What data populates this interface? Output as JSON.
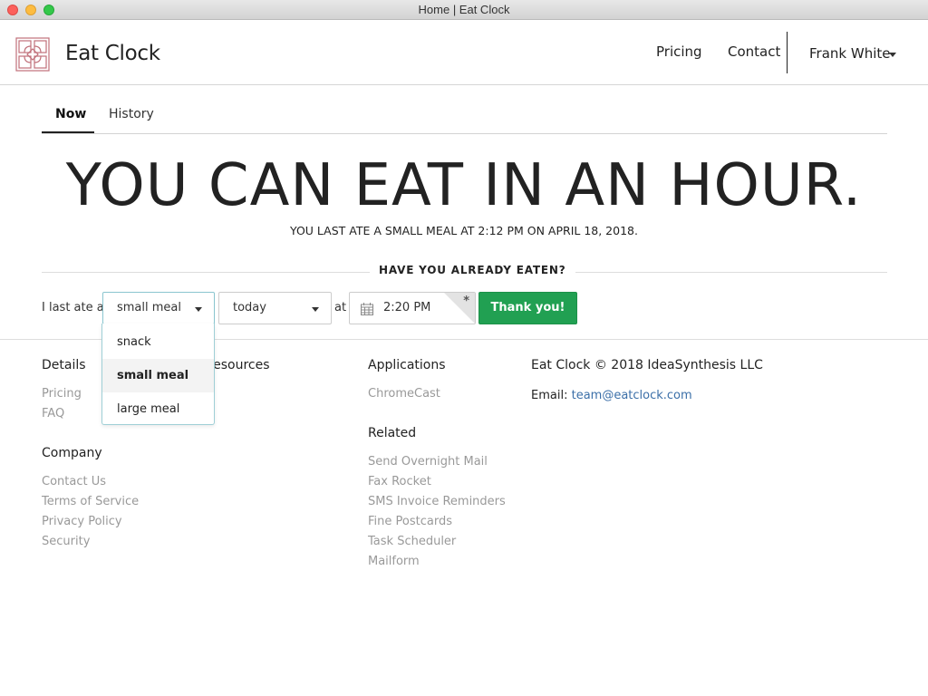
{
  "window": {
    "title": "Home | Eat Clock"
  },
  "navbar": {
    "brand": "Eat Clock",
    "links": [
      "Pricing",
      "Contact"
    ],
    "user": "Frank White"
  },
  "tabs": [
    {
      "label": "Now",
      "active": true
    },
    {
      "label": "History",
      "active": false
    }
  ],
  "status": {
    "headline": "YOU CAN EAT IN AN HOUR.",
    "last_meal": "YOU LAST ATE A SMALL MEAL AT 2:12 PM ON APRIL 18, 2018."
  },
  "form": {
    "section_title": "HAVE YOU ALREADY EATEN?",
    "label_prefix": "I last ate a",
    "meal_selected": "small meal",
    "meal_options": [
      "snack",
      "small meal",
      "large meal"
    ],
    "day_selected": "today",
    "label_at": "at",
    "time_value": "2:20 PM",
    "required_mark": "*",
    "submit_label": "Thank you!"
  },
  "footer": {
    "details": {
      "heading": "Details",
      "links": [
        "Pricing",
        "FAQ"
      ]
    },
    "resources": {
      "heading": "Resources"
    },
    "company": {
      "heading": "Company",
      "links": [
        "Contact Us",
        "Terms of Service",
        "Privacy Policy",
        "Security"
      ]
    },
    "applications": {
      "heading": "Applications",
      "links": [
        "ChromeCast"
      ]
    },
    "related": {
      "heading": "Related",
      "links": [
        "Send Overnight Mail",
        "Fax Rocket",
        "SMS Invoice Reminders",
        "Fine Postcards",
        "Task Scheduler",
        "Mailform"
      ]
    },
    "copyright": "Eat Clock © 2018 IdeaSynthesis LLC",
    "email_label": "Email:",
    "email": "team@eatclock.com"
  },
  "colors": {
    "accent_green": "#21a052",
    "link_blue": "#3b6fa8",
    "logo": "#c0707a"
  }
}
